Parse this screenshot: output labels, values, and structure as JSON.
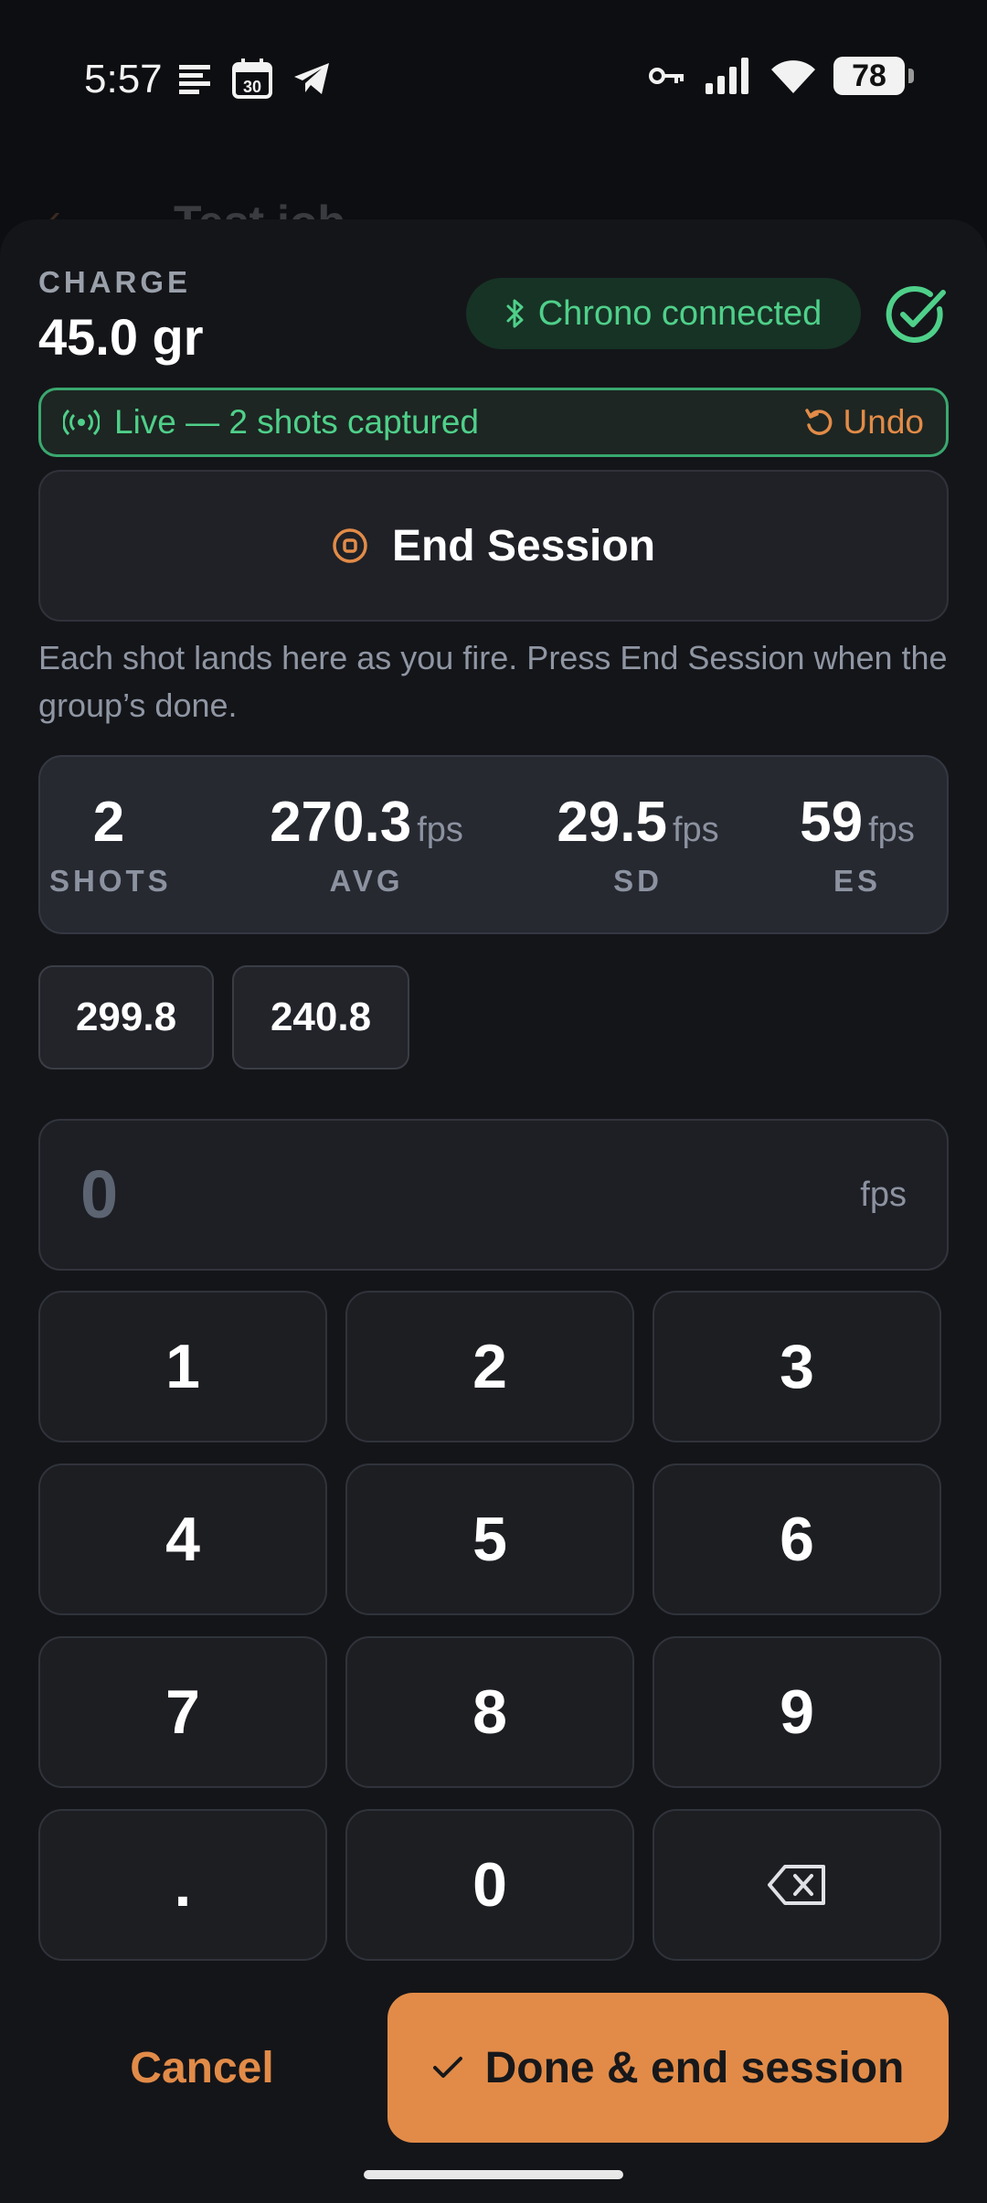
{
  "status_bar": {
    "time": "5:57",
    "calendar_day": "30",
    "battery": "78"
  },
  "behind_header": {
    "title": "Test job"
  },
  "charge": {
    "label": "CHARGE",
    "value": "45.0 gr"
  },
  "chrono": {
    "label": "Chrono connected",
    "color": "#4fd08a"
  },
  "live": {
    "text": "Live — 2 shots captured",
    "undo_label": "Undo"
  },
  "end_session_label": "End Session",
  "helper_text": "Each shot lands here as you fire. Press End Session when the group’s done.",
  "stats": [
    {
      "value": "2",
      "unit": "",
      "label": "SHOTS"
    },
    {
      "value": "270.3",
      "unit": "fps",
      "label": "AVG"
    },
    {
      "value": "29.5",
      "unit": "fps",
      "label": "SD"
    },
    {
      "value": "59",
      "unit": "fps",
      "label": "ES"
    }
  ],
  "shots": [
    "299.8",
    "240.8"
  ],
  "entry": {
    "value": "0",
    "unit": "fps"
  },
  "keypad": [
    "1",
    "2",
    "3",
    "4",
    "5",
    "6",
    "7",
    "8",
    "9",
    ".",
    "0",
    "backspace"
  ],
  "actions": {
    "cancel_label": "Cancel",
    "done_label": "Done & end session"
  },
  "colors": {
    "accent": "#e28b48",
    "success": "#4fd08a",
    "background": "#141519"
  }
}
